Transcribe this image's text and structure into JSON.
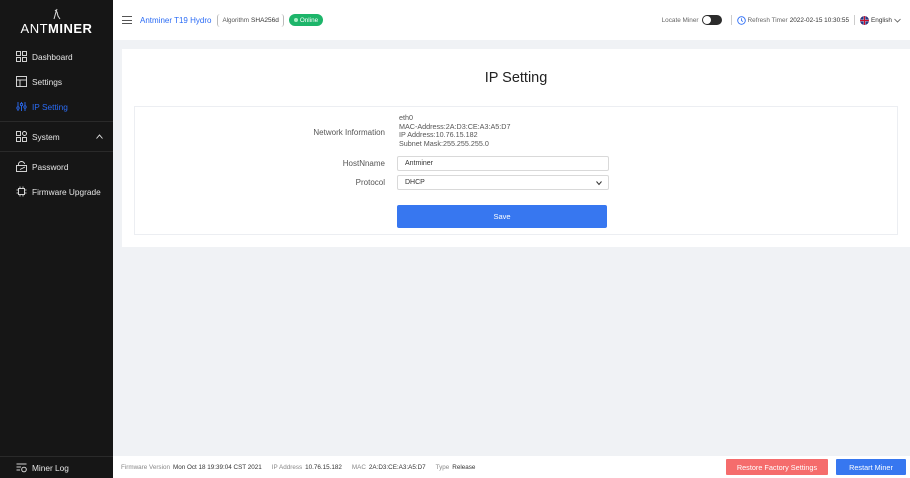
{
  "brand": {
    "logo_text_a": "ANT",
    "logo_text_b": "MINER"
  },
  "sidebar": {
    "items": [
      {
        "label": "Dashboard",
        "icon": "dashboard-icon"
      },
      {
        "label": "Settings",
        "icon": "settings-icon"
      },
      {
        "label": "IP Setting",
        "icon": "ip-setting-icon",
        "active": true
      },
      {
        "label": "System",
        "icon": "system-icon"
      },
      {
        "label": "Password",
        "icon": "password-icon"
      },
      {
        "label": "Firmware Upgrade",
        "icon": "firmware-icon"
      }
    ],
    "miner_log": "Miner Log"
  },
  "header": {
    "model": "Antminer T19 Hydro",
    "algorithm_label": "Algorithm",
    "algorithm_value": "SHA256d",
    "status": "Online",
    "locate_label": "Locate Miner",
    "refresh_label": "Refresh Timer",
    "refresh_value": "2022-02-15 10:30:55",
    "language": "English"
  },
  "main": {
    "title": "IP Setting",
    "network_label": "Network Information",
    "network_lines": [
      "eth0",
      "MAC-Address:2A:D3:CE:A3:A5:D7",
      "IP Address:10.76.15.182",
      "Subnet Mask:255.255.255.0"
    ],
    "hostname_label": "HostNname",
    "hostname_value": "Antminer",
    "protocol_label": "Protocol",
    "protocol_value": "DHCP",
    "save_label": "Save"
  },
  "footer": {
    "fw_label": "Firmware Version",
    "fw_value": "Mon Oct 18 19:39:04 CST 2021",
    "ip_label": "IP Address",
    "ip_value": "10.76.15.182",
    "mac_label": "MAC",
    "mac_value": "2A:D3:CE:A3:A5:D7",
    "type_label": "Type",
    "type_value": "Release",
    "reset_label": "Restore Factory Settings",
    "restart_label": "Restart Miner"
  },
  "colors": {
    "accent": "#3777f0",
    "danger": "#f56c6c",
    "online": "#1db56a",
    "sidebar_bg": "#161616"
  }
}
